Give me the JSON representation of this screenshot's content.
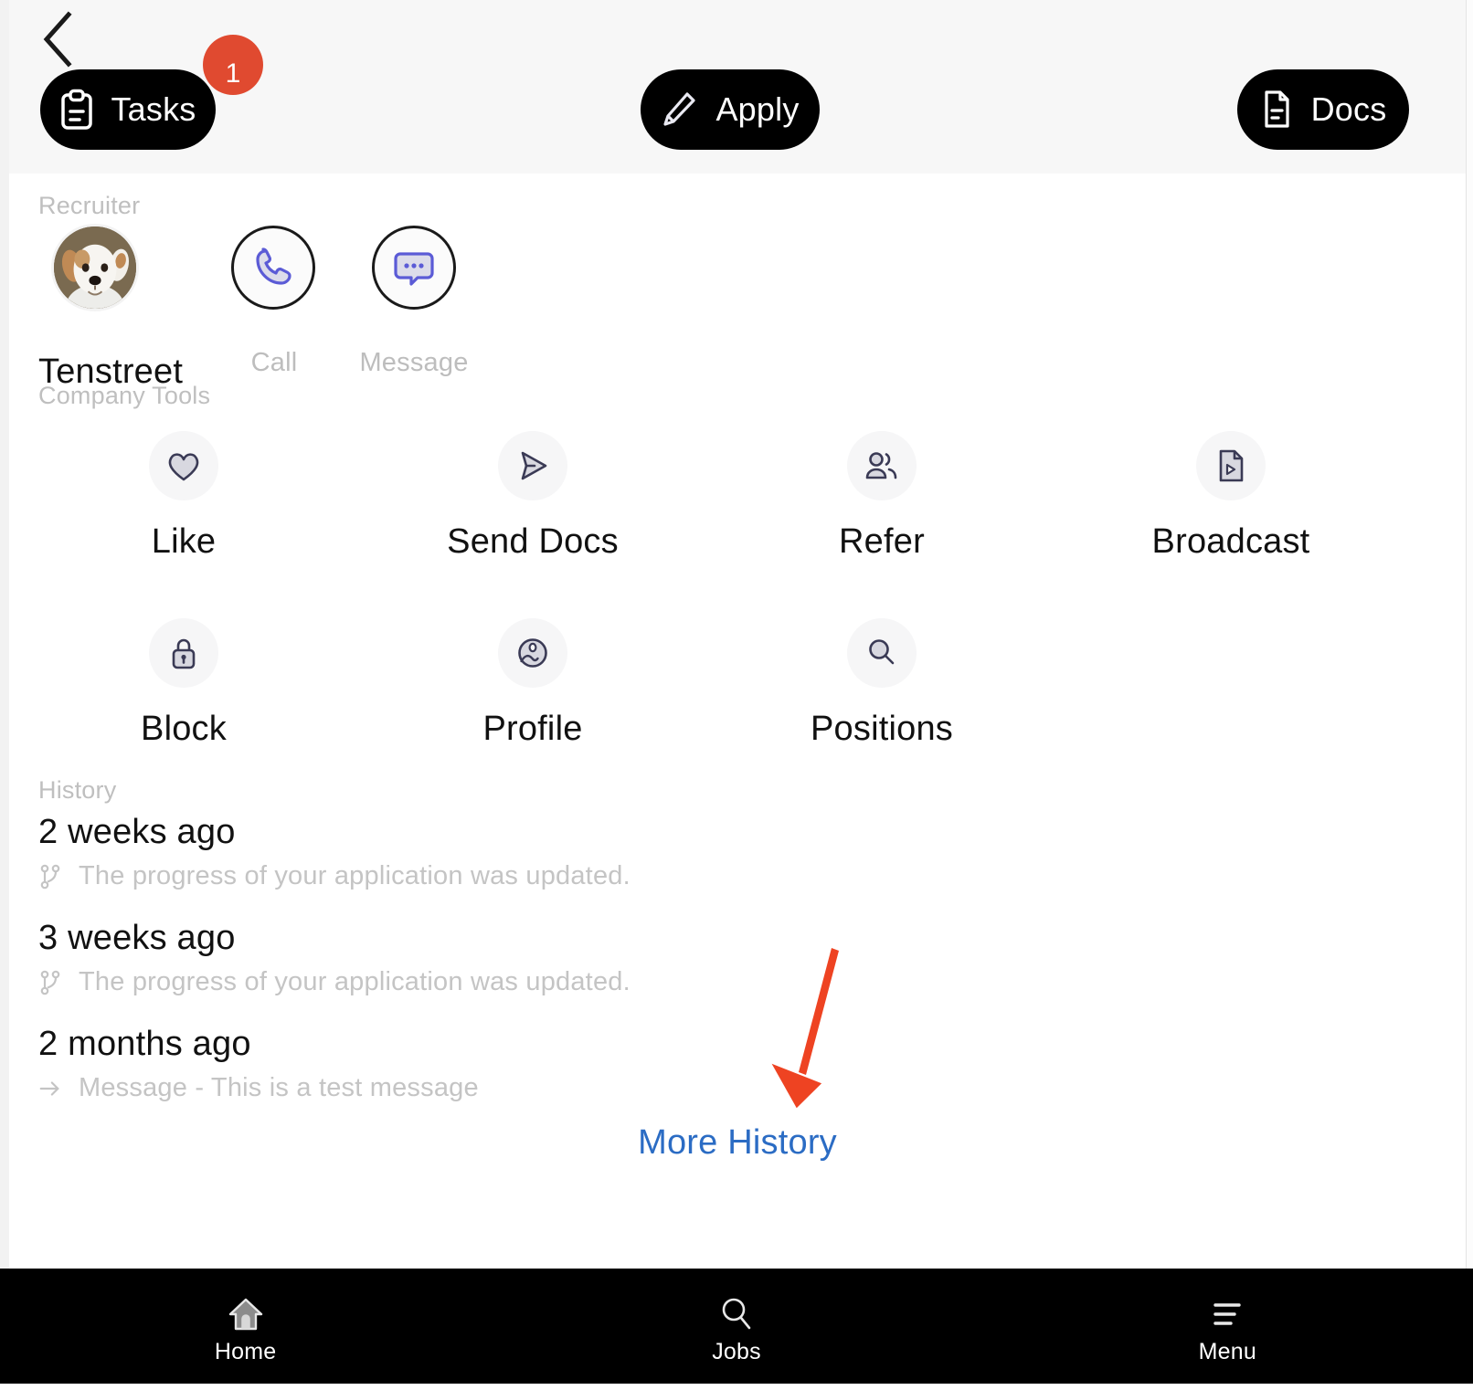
{
  "header": {
    "back_icon": "chevron-left-icon",
    "tasks": {
      "label": "Tasks",
      "icon": "clipboard-icon",
      "badge": "1"
    },
    "apply": {
      "label": "Apply",
      "icon": "pencil-icon"
    },
    "docs": {
      "label": "Docs",
      "icon": "document-icon"
    }
  },
  "recruiter": {
    "section_label": "Recruiter",
    "name": "Tenstreet",
    "avatar_icon": "dog-avatar",
    "actions": [
      {
        "label": "Call",
        "icon": "phone-icon"
      },
      {
        "label": "Message",
        "icon": "chat-bubble-icon"
      }
    ]
  },
  "company_tools": {
    "section_label": "Company Tools",
    "items": [
      {
        "label": "Like",
        "icon": "heart-icon"
      },
      {
        "label": "Send Docs",
        "icon": "send-icon"
      },
      {
        "label": "Refer",
        "icon": "users-icon"
      },
      {
        "label": "Broadcast",
        "icon": "video-file-icon"
      },
      {
        "label": "Block",
        "icon": "lock-icon"
      },
      {
        "label": "Profile",
        "icon": "image-icon"
      },
      {
        "label": "Positions",
        "icon": "magnifier-icon"
      }
    ]
  },
  "history": {
    "section_label": "History",
    "items": [
      {
        "time": "2 weeks ago",
        "icon": "branch-icon",
        "text": "The progress of your application was updated."
      },
      {
        "time": "3 weeks ago",
        "icon": "branch-icon",
        "text": "The progress of your application was updated."
      },
      {
        "time": "2 months ago",
        "icon": "arrow-right-icon",
        "text": "Message - This is a test message"
      }
    ],
    "more_link": "More History"
  },
  "bottom_nav": {
    "items": [
      {
        "label": "Home",
        "icon": "home-icon"
      },
      {
        "label": "Jobs",
        "icon": "search-icon"
      },
      {
        "label": "Menu",
        "icon": "hamburger-icon"
      }
    ]
  },
  "colors": {
    "accent_black": "#000000",
    "badge_red": "#e04a30",
    "link_blue": "#2b6cc4",
    "icon_indigo": "#5b5bd6",
    "icon_navy": "#3a3a55",
    "annotation_red": "#ee4322"
  }
}
